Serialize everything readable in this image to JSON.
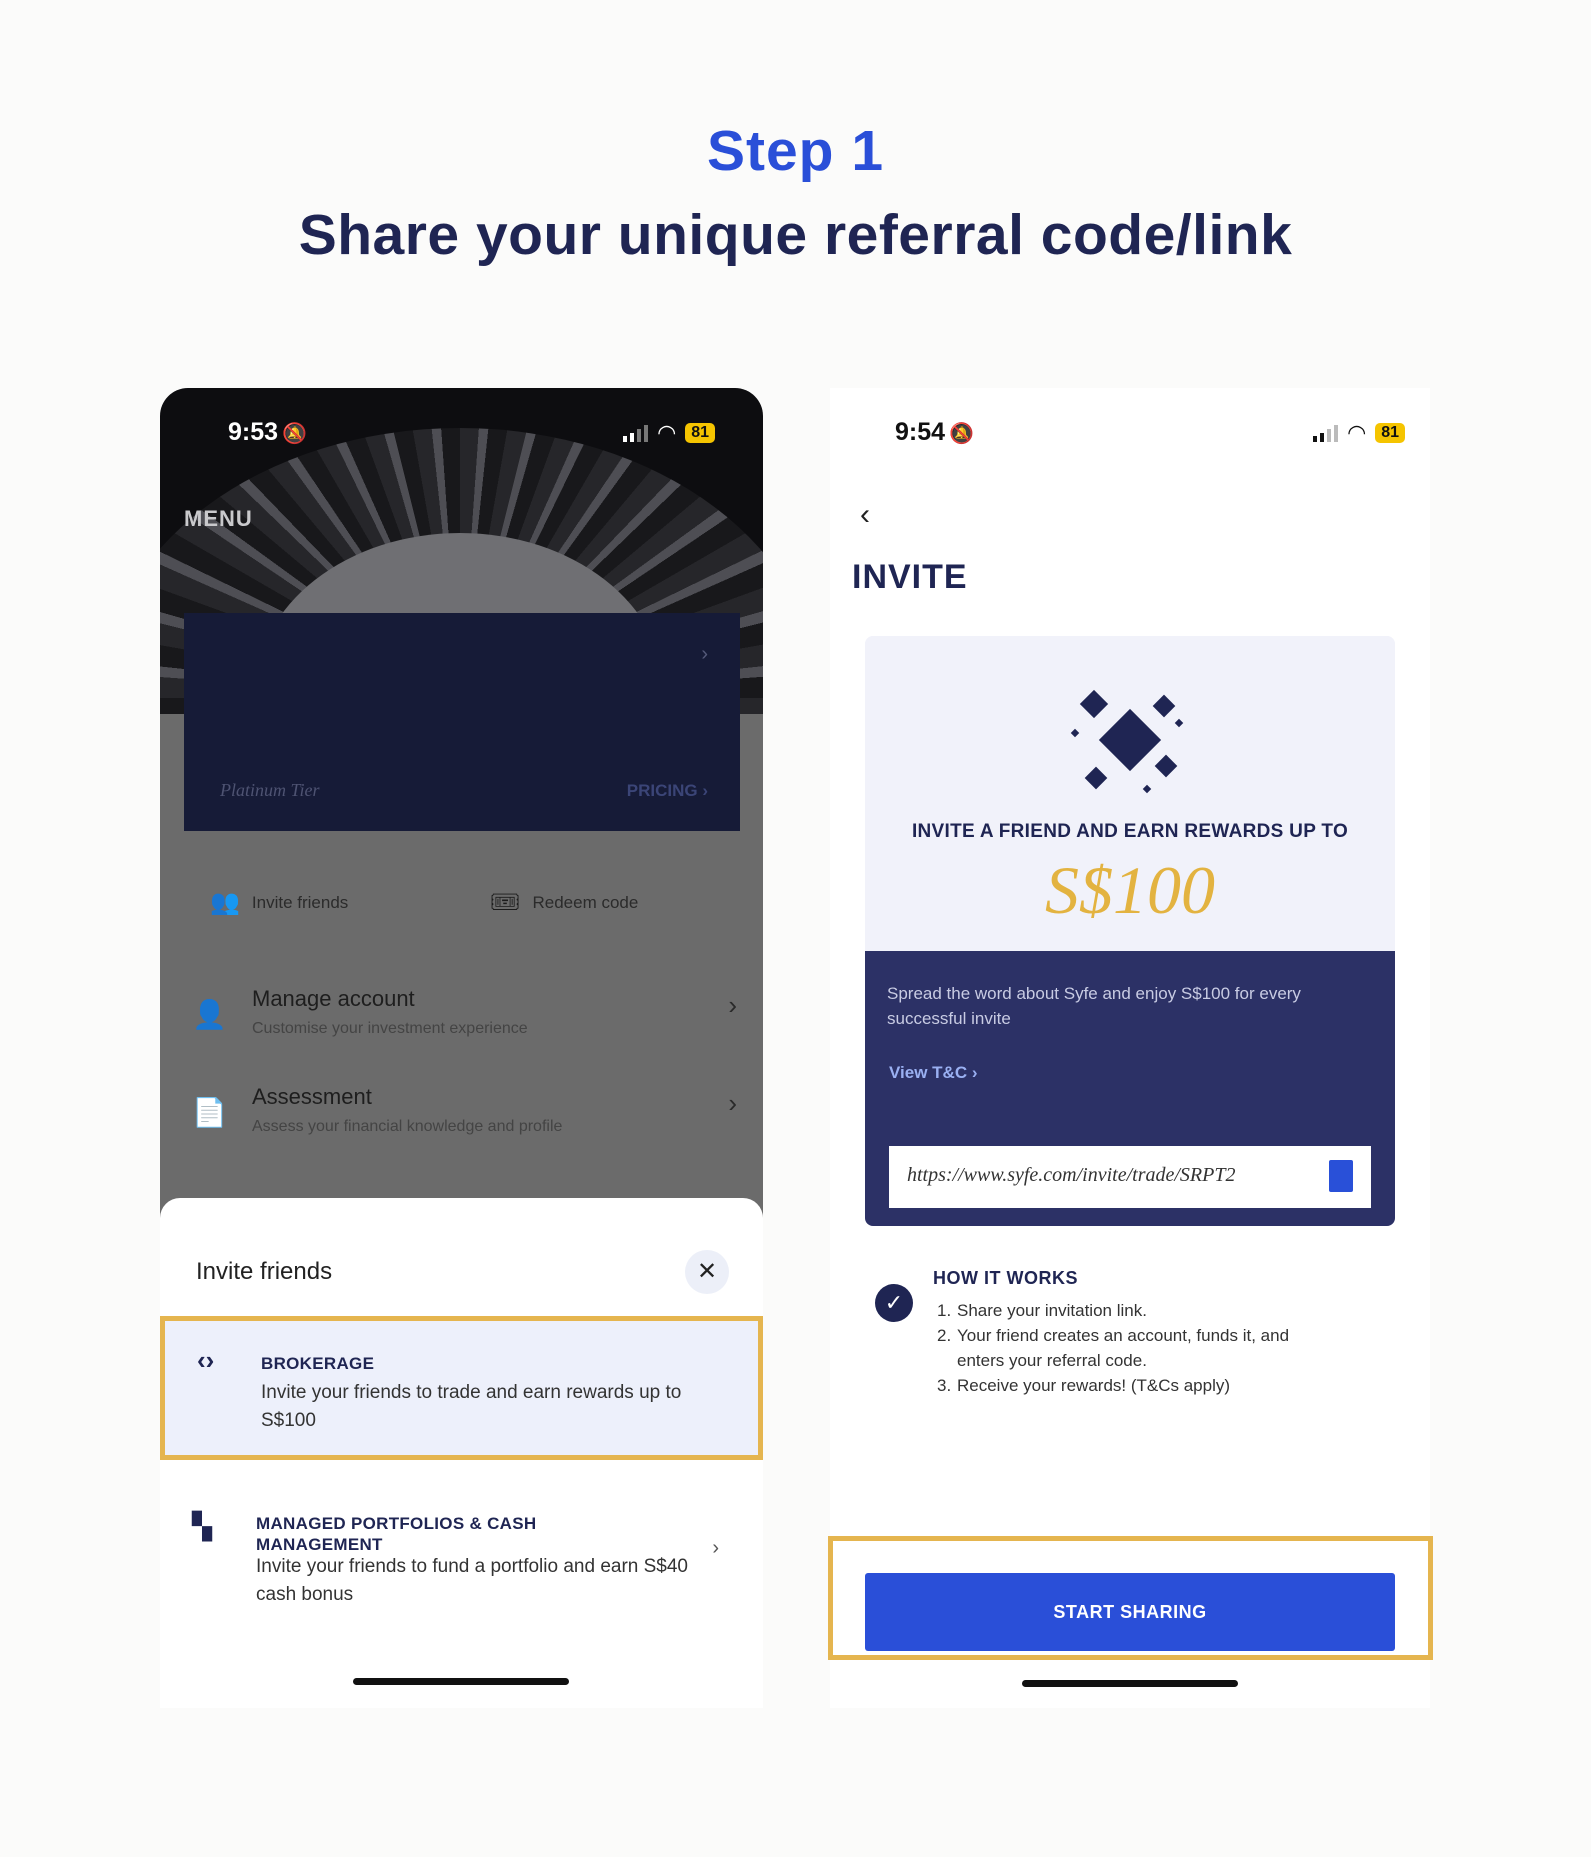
{
  "header": {
    "step": "Step 1",
    "subtitle": "Share your unique referral code/link"
  },
  "left_phone": {
    "status": {
      "time": "9:53",
      "battery": "81"
    },
    "menu_label": "MENU",
    "tier_card": {
      "tier_name": "Platinum Tier",
      "pricing_label": "PRICING"
    },
    "quick_actions": [
      {
        "label": "Invite friends",
        "icon": "add-person-icon"
      },
      {
        "label": "Redeem code",
        "icon": "ticket-icon"
      }
    ],
    "menu_items": [
      {
        "title": "Manage account",
        "subtitle": "Customise your investment experience",
        "icon": "person-icon"
      },
      {
        "title": "Assessment",
        "subtitle": "Assess your financial knowledge and profile",
        "icon": "document-icon"
      }
    ],
    "sheet": {
      "title": "Invite friends",
      "options": [
        {
          "title": "BROKERAGE",
          "description": "Invite your friends to trade and earn rewards up to S$100",
          "icon": "brokerage-icon"
        },
        {
          "title": "MANAGED PORTFOLIOS & CASH MANAGEMENT",
          "description": "Invite your friends to fund a portfolio and earn S$40 cash bonus",
          "icon": "portfolio-icon"
        }
      ]
    }
  },
  "right_phone": {
    "status": {
      "time": "9:54",
      "battery": "81"
    },
    "title": "INVITE",
    "card": {
      "headline": "INVITE A FRIEND AND EARN REWARDS UP TO",
      "amount": "S$100",
      "description": "Spread the word about Syfe and enjoy S$100 for every successful invite",
      "tc_link": "View T&C",
      "referral_link": "https://www.syfe.com/invite/trade/SRPT2"
    },
    "how_it_works": {
      "title": "HOW IT WORKS",
      "steps": [
        "Share your invitation link.",
        "Your friend creates an account, funds it, and enters your referral code.",
        "Receive your rewards! (T&Cs apply)"
      ]
    },
    "cta": "START SHARING"
  },
  "colors": {
    "accent_blue": "#2a4fd8",
    "navy": "#1f2553",
    "gold_highlight": "#e5b54f",
    "gold_amount": "#e3b340"
  }
}
